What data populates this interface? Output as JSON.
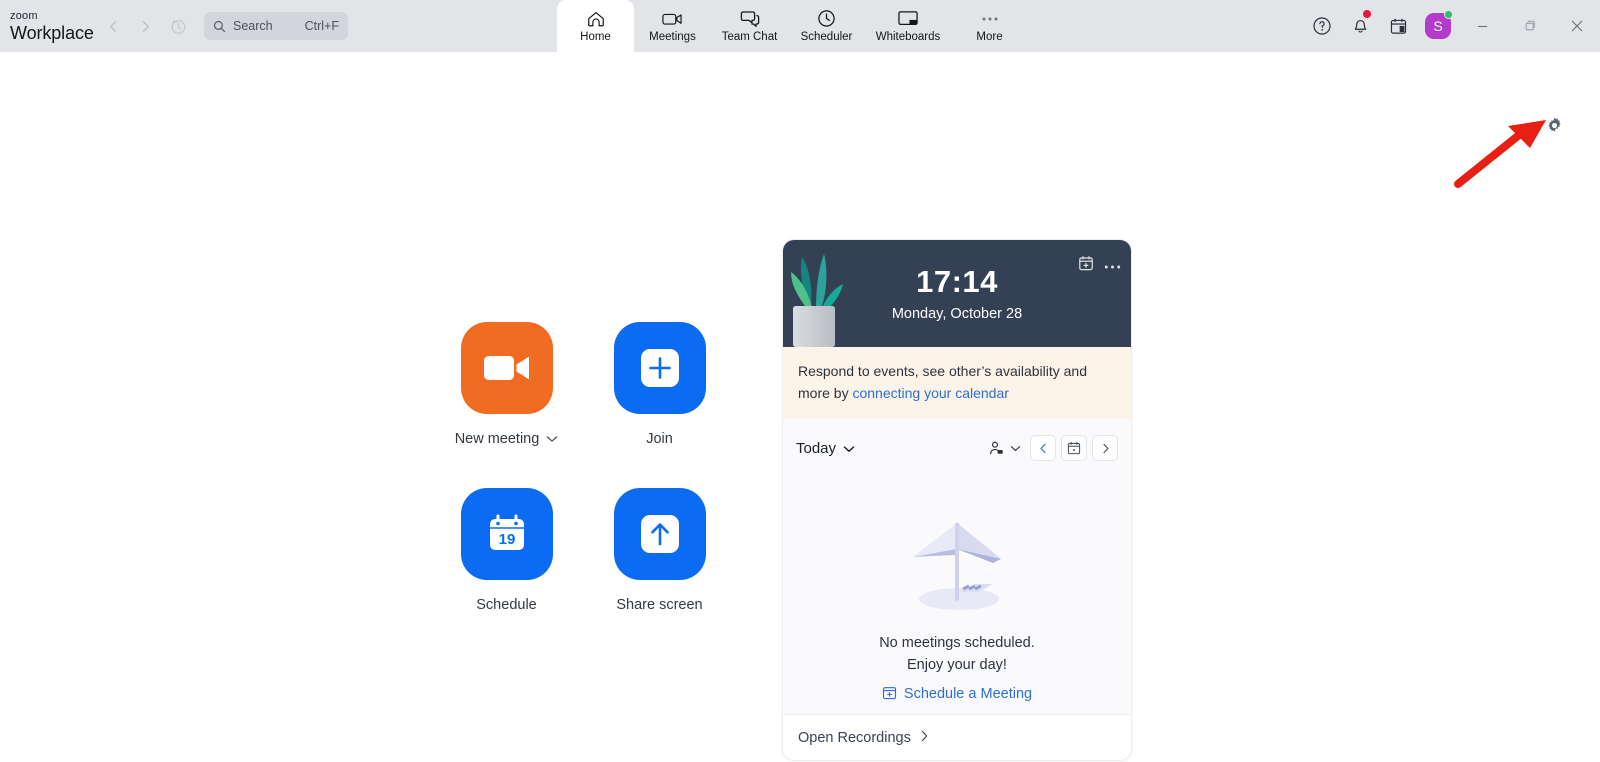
{
  "app": {
    "brand_top": "zoom",
    "brand_main": "Workplace",
    "accent_blue": "#0b6cf3",
    "accent_orange": "#f06c23",
    "titlebar_bg": "#e2e4e8",
    "hero_bg": "#344154",
    "banner_bg": "#fdf4e9",
    "avatar_bg": "#b23bc9",
    "annotation_arrow_color": "#e81f13"
  },
  "titlebar": {
    "back_label": "back-arrow",
    "forward_label": "forward-arrow",
    "history_label": "history-icon",
    "search": {
      "placeholder": "Search",
      "shortcut": "Ctrl+F"
    },
    "tabs": [
      {
        "label": "Home",
        "icon": "home-icon",
        "active": true
      },
      {
        "label": "Meetings",
        "icon": "video-camera-icon",
        "active": false
      },
      {
        "label": "Team Chat",
        "icon": "chat-bubbles-icon",
        "active": false
      },
      {
        "label": "Scheduler",
        "icon": "clock-icon",
        "active": false
      },
      {
        "label": "Whiteboards",
        "icon": "whiteboard-icon",
        "active": false
      },
      {
        "label": "More",
        "icon": "ellipsis-icon",
        "active": false
      }
    ],
    "system": {
      "help": "help-circle-icon",
      "notifications": "bell-icon",
      "calendar": "calendar-icon",
      "avatar_initial": "S",
      "minimize": "minimize-icon",
      "maximize": "maximize-icon",
      "close": "close-icon"
    }
  },
  "main": {
    "settings_gear": "gear-icon",
    "actions": [
      {
        "label": "New meeting",
        "icon": "video-camera-icon",
        "color": "orange",
        "has_caret": true
      },
      {
        "label": "Join",
        "icon": "plus-square-icon",
        "color": "blue",
        "has_caret": false
      },
      {
        "label": "Schedule",
        "icon": "calendar-19-icon",
        "color": "blue",
        "has_caret": false,
        "calendar_day": "19"
      },
      {
        "label": "Share screen",
        "icon": "arrow-up-square-icon",
        "color": "blue",
        "has_caret": false
      }
    ]
  },
  "calendar_card": {
    "time": "17:14",
    "date": "Monday, October 28",
    "hero_icons": [
      "calendar-plus-icon",
      "more-options-icon"
    ],
    "banner": {
      "text_before": "Respond to events, see other’s availability and more by ",
      "link_text": "connecting your calendar"
    },
    "toolbar": {
      "today_label": "Today",
      "today_caret": "chevron-down-icon",
      "person_filter": "person-filter-icon",
      "prev": "chevron-left-icon",
      "date_picker": "calendar-icon",
      "next": "chevron-right-icon"
    },
    "empty_state": {
      "illustration": "beach-umbrella-icon",
      "line1": "No meetings scheduled.",
      "line2": "Enjoy your day!",
      "link_label": "Schedule a Meeting",
      "link_icon": "calendar-plus-icon"
    },
    "footer": {
      "label": "Open Recordings",
      "chevron": "chevron-right-icon"
    }
  }
}
